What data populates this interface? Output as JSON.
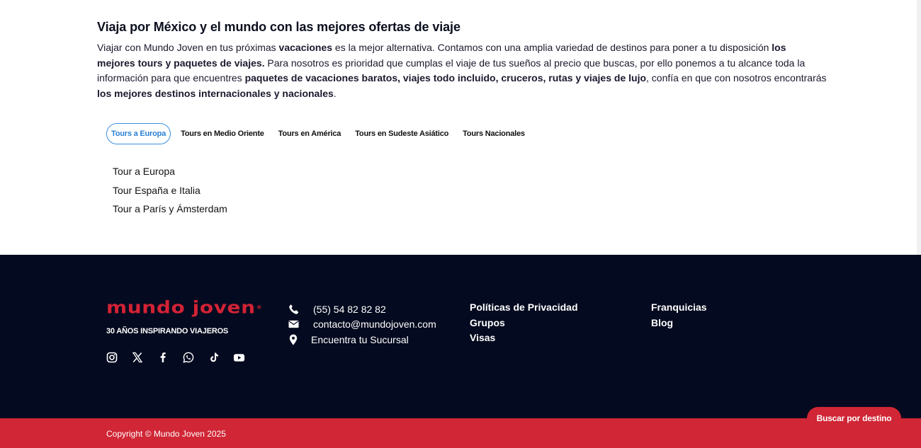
{
  "intro": {
    "heading": "Viaja por México y el mundo con las mejores ofertas de viaje",
    "paragraph": [
      {
        "text": "Viajar con Mundo Joven en tus próximas ",
        "bold": false
      },
      {
        "text": "vacaciones",
        "bold": true
      },
      {
        "text": " es la mejor alternativa. Contamos con una amplia variedad de destinos para poner a tu disposición ",
        "bold": false
      },
      {
        "text": "los mejores tours y paquetes de viajes.",
        "bold": true
      },
      {
        "text": " Para nosotros es prioridad que cumplas el viaje de tus sueños al precio que buscas, por ello ponemos a tu alcance toda la información para que encuentres ",
        "bold": false
      },
      {
        "text": "paquetes de vacaciones baratos, viajes todo incluido, cruceros, rutas y viajes de lujo",
        "bold": true
      },
      {
        "text": ", confía en que con nosotros encontrarás ",
        "bold": false
      },
      {
        "text": "los mejores destinos internacionales y nacionales",
        "bold": true
      },
      {
        "text": ".",
        "bold": false
      }
    ]
  },
  "tabs": {
    "active": 0,
    "items": [
      {
        "label": "Tours a Europa"
      },
      {
        "label": "Tours en Medio Oriente"
      },
      {
        "label": "Tours en América"
      },
      {
        "label": "Tours en Sudeste Asiático"
      },
      {
        "label": "Tours Nacionales"
      }
    ]
  },
  "tour_list": [
    {
      "label": "Tour a Europa"
    },
    {
      "label": "Tour España e Italia"
    },
    {
      "label": "Tour a París y Ámsterdam"
    }
  ],
  "footer": {
    "logo_text": "mundo joven",
    "logo_reg": "®",
    "tagline": "30 AÑOS INSPIRANDO VIAJEROS",
    "social_icons": [
      "instagram-icon",
      "x-icon",
      "facebook-icon",
      "whatsapp-icon",
      "tiktok-icon",
      "youtube-icon"
    ],
    "contact": {
      "phone": "(55) 54 82 82 82",
      "email": "contacto@mundojoven.com",
      "branch": "Encuentra tu Sucursal"
    },
    "links_col2": [
      {
        "label": "Políticas de Privacidad"
      },
      {
        "label": "Grupos"
      },
      {
        "label": "Visas"
      }
    ],
    "links_col3": [
      {
        "label": "Franquicias"
      },
      {
        "label": "Blog"
      }
    ],
    "copyright": "Copyright © Mundo Joven 2025"
  },
  "search_button": {
    "label": "Buscar por destino"
  },
  "colors": {
    "brand_red": "#d02635",
    "footer_bg": "#040a1f",
    "tab_active_blue": "#2a7fd4"
  }
}
